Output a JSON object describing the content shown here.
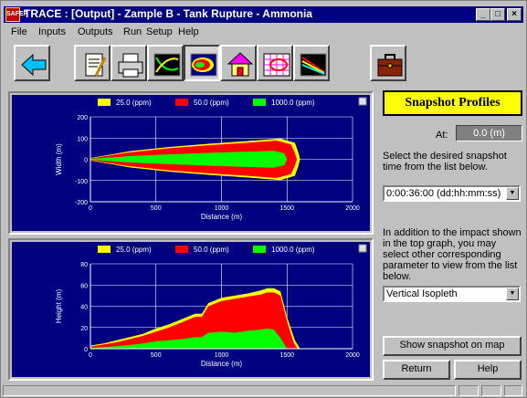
{
  "window": {
    "title": "TRACE : [Output] - Zample B - Tank Rupture - Ammonia",
    "icon_label": "SAFER",
    "controls": [
      "_",
      "□",
      "×"
    ]
  },
  "menu": [
    "File",
    "Inputs",
    "Outputs",
    "Run",
    "Setup",
    "Help"
  ],
  "toolbar": {
    "buttons": [
      "back-arrow-icon",
      "notepad-icon",
      "printer-icon",
      "curve-chart-icon",
      "footprint-contour-icon",
      "house-infiltration-icon",
      "grid-map-icon",
      "multi-line-chart-icon",
      "briefcase-icon"
    ],
    "active": "footprint-contour-icon"
  },
  "colors": {
    "plot_bg": "#000080",
    "band_25": "#ffff00",
    "band_50": "#ff0000",
    "band_1000": "#00ff00",
    "snapshot_header": "#ffff00"
  },
  "chart_data": [
    {
      "type": "area",
      "title": "",
      "xlabel": "Distance (m)",
      "ylabel": "Width (m)",
      "xlim": [
        0,
        2000
      ],
      "ylim": [
        -200,
        200
      ],
      "x_ticks": [
        0,
        500,
        1000,
        1500,
        2000
      ],
      "y_ticks": [
        -200,
        -100,
        0,
        100,
        200
      ],
      "grid": true,
      "legend_position": "top",
      "symmetric_about_zero": true,
      "series": [
        {
          "name": "25.0 (ppm)",
          "color": "#ffff00",
          "x": [
            0,
            300,
            600,
            900,
            1200,
            1450,
            1560,
            1585,
            1600
          ],
          "y": [
            6,
            38,
            58,
            73,
            86,
            98,
            78,
            35,
            0
          ]
        },
        {
          "name": "50.0 (ppm)",
          "color": "#ff0000",
          "x": [
            0,
            300,
            600,
            900,
            1200,
            1420,
            1530,
            1560,
            1575
          ],
          "y": [
            4,
            33,
            52,
            66,
            78,
            88,
            70,
            30,
            0
          ]
        },
        {
          "name": "1000.0 (ppm)",
          "color": "#00ff00",
          "x": [
            0,
            300,
            600,
            900,
            1200,
            1400,
            1480,
            1500
          ],
          "y": [
            2,
            15,
            23,
            30,
            36,
            40,
            28,
            0
          ]
        }
      ]
    },
    {
      "type": "area",
      "title": "",
      "xlabel": "Distance (m)",
      "ylabel": "Height (m)",
      "xlim": [
        0,
        2000
      ],
      "ylim": [
        0,
        80
      ],
      "x_ticks": [
        0,
        500,
        1000,
        1500,
        2000
      ],
      "y_ticks": [
        0,
        20,
        40,
        60,
        80
      ],
      "grid": true,
      "legend_position": "top",
      "series": [
        {
          "name": "25.0 (ppm)",
          "color": "#ffff00",
          "x": [
            0,
            100,
            200,
            300,
            400,
            500,
            600,
            700,
            800,
            850,
            900,
            1000,
            1100,
            1200,
            1300,
            1350,
            1400,
            1450,
            1500,
            1560,
            1600
          ],
          "y": [
            3,
            5,
            8,
            11,
            14,
            19,
            23,
            28,
            33,
            33,
            43,
            48,
            50,
            52,
            55,
            57,
            57,
            54,
            30,
            8,
            0
          ]
        },
        {
          "name": "50.0 (ppm)",
          "color": "#ff0000",
          "x": [
            0,
            100,
            200,
            300,
            400,
            500,
            600,
            700,
            800,
            850,
            900,
            1000,
            1100,
            1200,
            1300,
            1350,
            1400,
            1450,
            1500,
            1550,
            1580
          ],
          "y": [
            2,
            4,
            6,
            9,
            12,
            16,
            20,
            25,
            30,
            30,
            40,
            45,
            47,
            49,
            51,
            53,
            53,
            50,
            26,
            6,
            0
          ]
        },
        {
          "name": "1000.0 (ppm)",
          "color": "#00ff00",
          "x": [
            0,
            100,
            200,
            300,
            400,
            500,
            600,
            700,
            800,
            850,
            900,
            1000,
            1100,
            1200,
            1300,
            1350,
            1400,
            1450,
            1500
          ],
          "y": [
            1,
            1.5,
            2.5,
            3.5,
            5,
            7,
            8,
            9,
            11,
            11,
            15,
            16,
            15,
            17,
            18,
            19,
            18,
            10,
            0
          ]
        }
      ]
    }
  ],
  "side": {
    "title": "Snapshot Profiles",
    "at_label": "At:",
    "at_value": "0.0 (m)",
    "instructions_1": "Select the desired snapshot time from the list below.",
    "time_select": "0:00:36:00 (dd:hh:mm:ss)",
    "instructions_2": "In addition to the impact shown in the top graph, you may select other corresponding parameter to view from the list below.",
    "param_select": "Vertical Isopleth",
    "show_map_button": "Show snapshot on map",
    "return_button": "Return",
    "help_button": "Help"
  }
}
